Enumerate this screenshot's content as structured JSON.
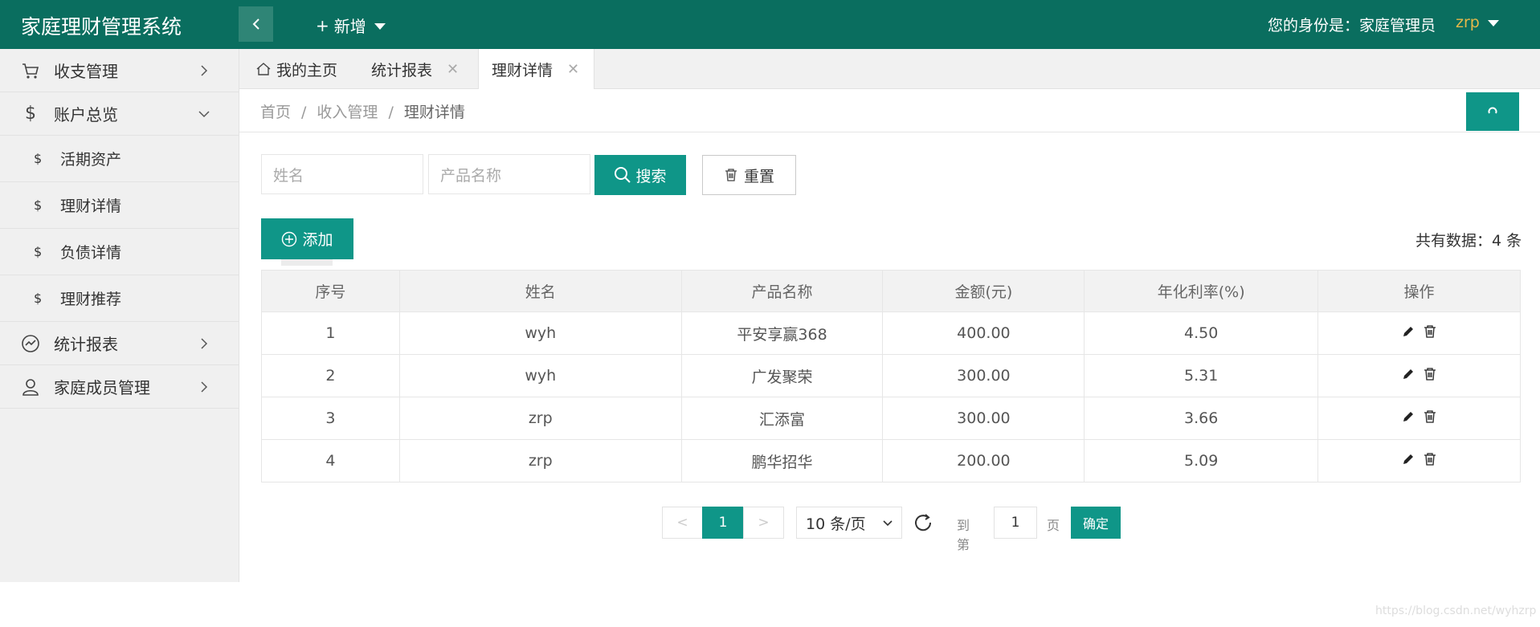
{
  "header": {
    "logo": "家庭理财管理系统",
    "add_new": "新增",
    "identity": "您的身份是：家庭管理员",
    "user": "zrp"
  },
  "sidebar": {
    "items": [
      {
        "label": "收支管理",
        "icon": "cart-icon",
        "expanded": false
      },
      {
        "label": "账户总览",
        "icon": "dollar-icon",
        "expanded": true,
        "children": [
          "活期资产",
          "理财详情",
          "负债详情",
          "理财推荐"
        ]
      },
      {
        "label": "统计报表",
        "icon": "chart-icon",
        "expanded": false
      },
      {
        "label": "家庭成员管理",
        "icon": "user-icon",
        "expanded": false
      }
    ]
  },
  "tabs": [
    {
      "label": "我的主页",
      "icon": "home-icon"
    },
    {
      "label": "统计报表",
      "closable": true
    },
    {
      "label": "理财详情",
      "closable": true,
      "active": true
    }
  ],
  "breadcrumb": [
    "首页",
    "收入管理",
    "理财详情"
  ],
  "search": {
    "name_placeholder": "姓名",
    "product_placeholder": "产品名称",
    "search_label": "搜索",
    "reset_label": "重置"
  },
  "toolbar": {
    "add_label": "添加",
    "total_text": "共有数据：4 条"
  },
  "table": {
    "headers": [
      "序号",
      "姓名",
      "产品名称",
      "金额(元)",
      "年化利率(%)",
      "操作"
    ],
    "rows": [
      [
        "1",
        "wyh",
        "平安享赢368",
        "400.00",
        "4.50"
      ],
      [
        "2",
        "wyh",
        "广发聚荣",
        "300.00",
        "5.31"
      ],
      [
        "3",
        "zrp",
        "汇添富",
        "300.00",
        "3.66"
      ],
      [
        "4",
        "zrp",
        "鹏华招华",
        "200.00",
        "5.09"
      ]
    ]
  },
  "pagination": {
    "prev": "<",
    "current": "1",
    "next": ">",
    "page_size": "10 条/页",
    "goto_label": "到第",
    "goto_value": "1",
    "page_label": "页",
    "confirm": "确定"
  },
  "watermark": "https://blog.csdn.net/wyhzrp",
  "colors": {
    "header_bg": "#0a6e5f",
    "accent": "#0f9688",
    "user": "#e6b84a"
  }
}
